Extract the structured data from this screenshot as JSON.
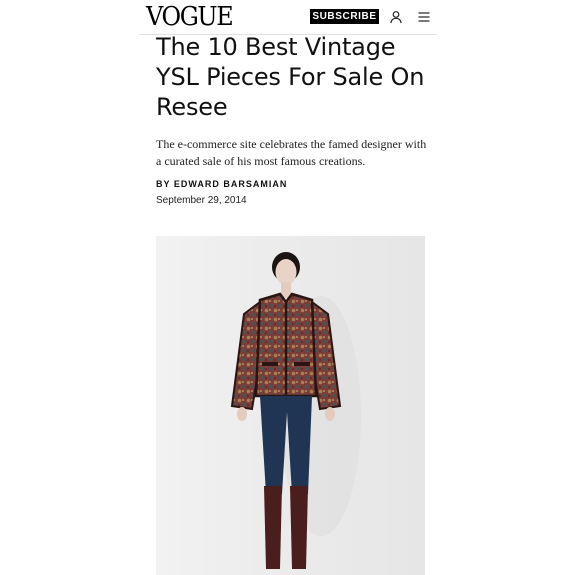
{
  "header": {
    "logo": "VOGUE",
    "subscribe_label": "SUBSCRIBE",
    "icons": [
      "user-icon",
      "menu-icon"
    ]
  },
  "article": {
    "title": "The 10 Best Vintage YSL Pieces For Sale On Resee",
    "dek": "The e-commerce site celebrates the famed designer with a curated sale of his most famous creations.",
    "byline": "BY EDWARD BARSAMIAN",
    "date": "September 29, 2014"
  },
  "colors": {
    "brand": "#000000",
    "text": "#111111",
    "jacket": "#7a3e3a",
    "jeans": "#1f3553",
    "boots": "#4a1e1c"
  }
}
